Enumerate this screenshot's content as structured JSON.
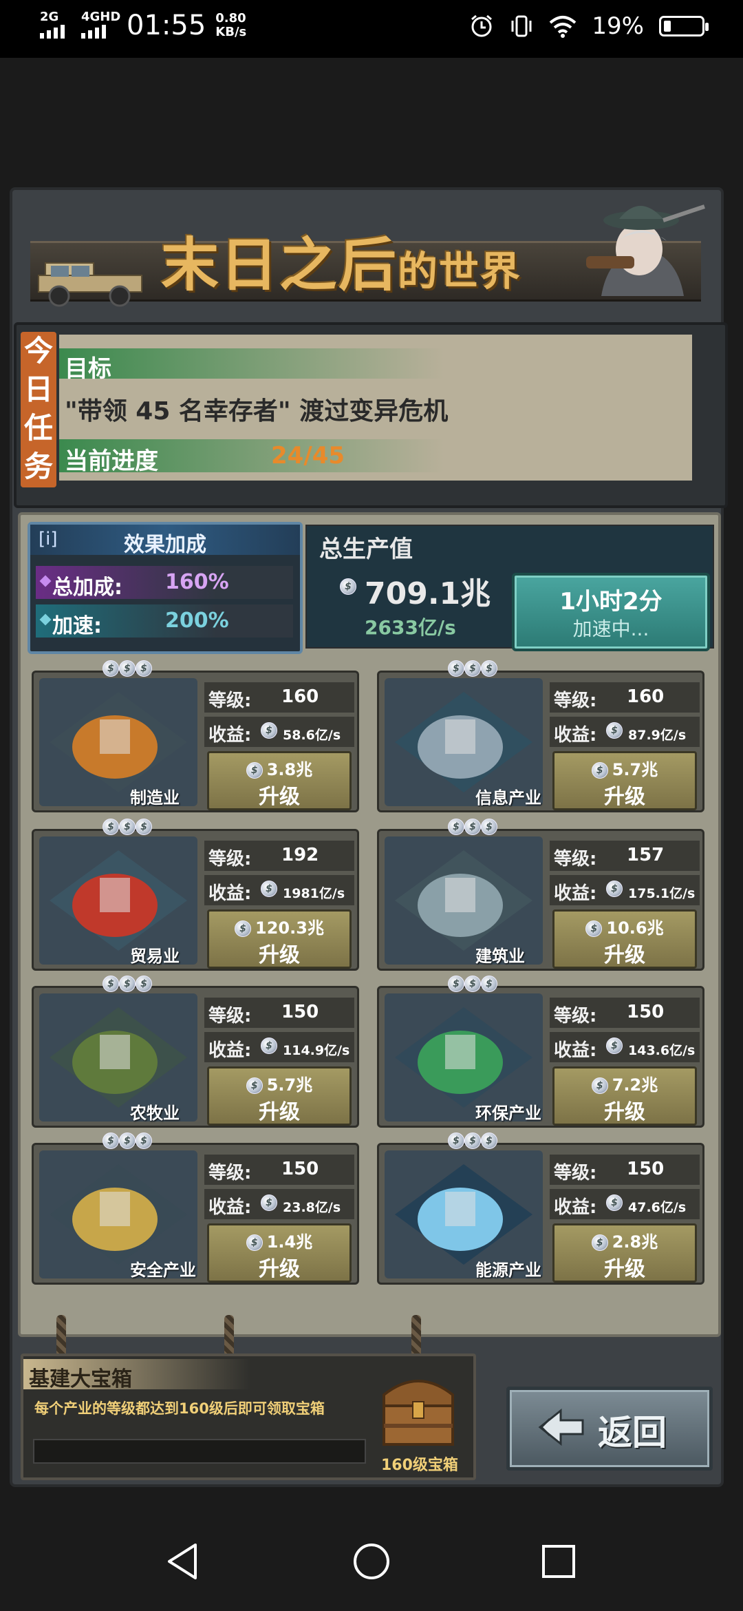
{
  "status_bar": {
    "signal1": "2G",
    "signal2": "4GHD",
    "time": "01:55",
    "speed_value": "0.80",
    "speed_unit": "KB/s",
    "battery_pct": "19%"
  },
  "game": {
    "title_main": "末日之后",
    "title_small": "的世界",
    "task": {
      "tab_chars": [
        "今",
        "日",
        "任",
        "务"
      ],
      "goal_label": "目标",
      "goal_text": "\"带领  45  名幸存者\" 渡过变异危机",
      "progress_label": "当前进度",
      "progress_value": "24/45"
    },
    "bonus": {
      "icon": "[i]",
      "title": "效果加成",
      "total_label": "总加成:",
      "total_value": "160%",
      "speed_label": "加速:",
      "speed_value": "200%"
    },
    "output": {
      "title": "总生产值",
      "total": "709.1兆",
      "rate": "2633亿/s",
      "accel_time": "1小时2分",
      "accel_status": "加速中..."
    },
    "level_key": "等级:",
    "income_key": "收益:",
    "upgrade_label": "升级",
    "industries": [
      {
        "name": "制造业",
        "level": "160",
        "income": "58.6亿/s",
        "cost": "3.8兆",
        "icon": "factory-robot-arm-icon"
      },
      {
        "name": "信息产业",
        "level": "160",
        "income": "87.9亿/s",
        "cost": "5.7兆",
        "icon": "satellite-icon"
      },
      {
        "name": "贸易业",
        "level": "192",
        "income": "1981亿/s",
        "cost": "120.3兆",
        "icon": "cargo-ship-icon"
      },
      {
        "name": "建筑业",
        "level": "157",
        "income": "175.1亿/s",
        "cost": "10.6兆",
        "icon": "city-buildings-icon"
      },
      {
        "name": "农牧业",
        "level": "150",
        "income": "114.9亿/s",
        "cost": "5.7兆",
        "icon": "harvester-icon"
      },
      {
        "name": "环保产业",
        "level": "150",
        "income": "143.6亿/s",
        "cost": "7.2兆",
        "icon": "tree-globe-icon"
      },
      {
        "name": "安全产业",
        "level": "150",
        "income": "23.8亿/s",
        "cost": "1.4兆",
        "icon": "gas-mask-icon"
      },
      {
        "name": "能源产业",
        "level": "150",
        "income": "47.6亿/s",
        "cost": "2.8兆",
        "icon": "energy-reactor-icon"
      }
    ],
    "chest": {
      "title": "基建大宝箱",
      "desc": "每个产业的等级都达到160级后即可领取宝箱",
      "label": "160级宝箱"
    },
    "back_label": "返回"
  }
}
